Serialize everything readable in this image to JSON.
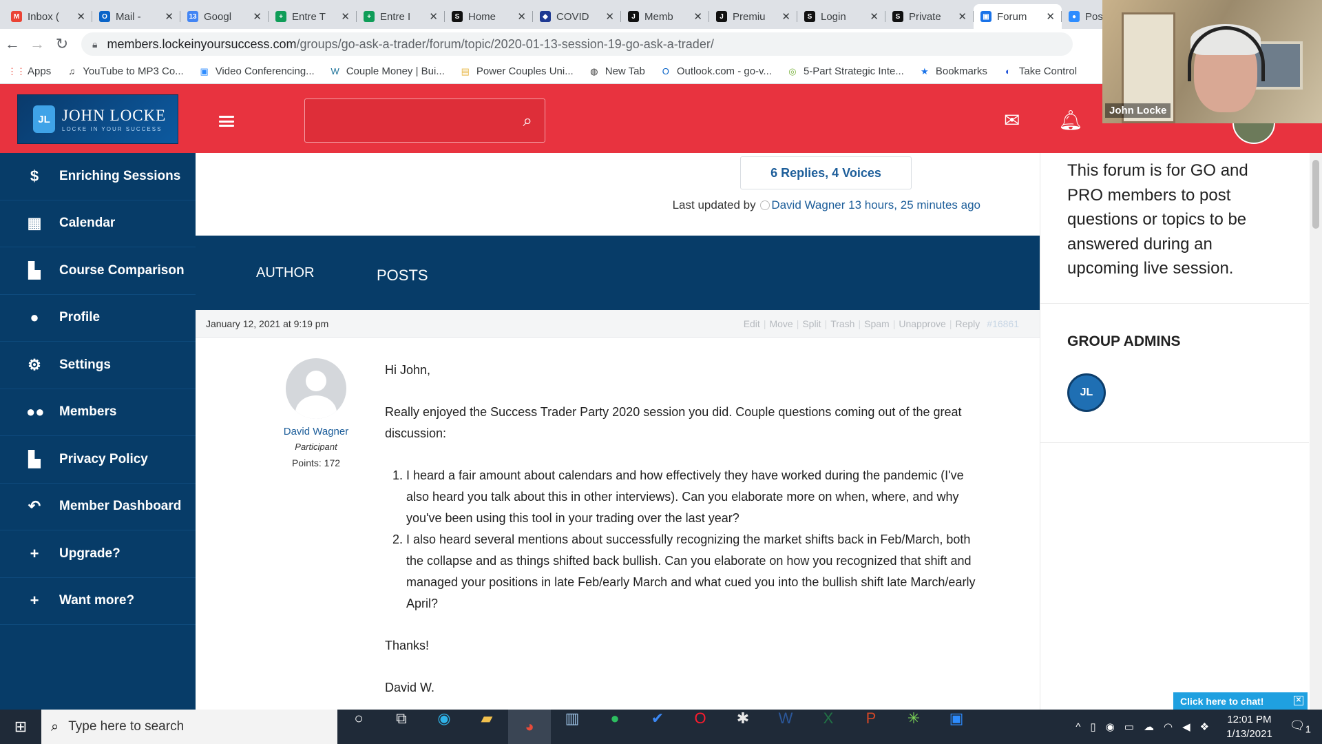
{
  "browser": {
    "tabs": [
      {
        "title": "Inbox (",
        "fav": "M",
        "color": "#ea4335",
        "active": false
      },
      {
        "title": "Mail -",
        "fav": "O",
        "color": "#0a64c8",
        "active": false
      },
      {
        "title": "Googl",
        "fav": "13",
        "color": "#4285f4",
        "active": false
      },
      {
        "title": "Entre T",
        "fav": "+",
        "color": "#0f9d58",
        "active": false
      },
      {
        "title": "Entre I",
        "fav": "+",
        "color": "#0f9d58",
        "active": false
      },
      {
        "title": "Home",
        "fav": "S",
        "color": "#111111",
        "active": false
      },
      {
        "title": "COVID",
        "fav": "◆",
        "color": "#1f3a93",
        "active": false
      },
      {
        "title": "Memb",
        "fav": "J",
        "color": "#111111",
        "active": false
      },
      {
        "title": "Premiu",
        "fav": "J",
        "color": "#111111",
        "active": false
      },
      {
        "title": "Login",
        "fav": "S",
        "color": "#111111",
        "active": false
      },
      {
        "title": "Private",
        "fav": "S",
        "color": "#111111",
        "active": false
      },
      {
        "title": "Forum",
        "fav": "▣",
        "color": "#1a73e8",
        "active": true
      },
      {
        "title": "Post A",
        "fav": "●",
        "color": "#2d8cff",
        "active": false
      }
    ],
    "url_domain": "members.lockeinyoursuccess.com",
    "url_path": "/groups/go-ask-a-trader/forum/topic/2020-01-13-session-19-go-ask-a-trader/",
    "bookmarks": [
      {
        "label": "Apps",
        "icon": "⋮⋮",
        "color": "#ea4335"
      },
      {
        "label": "YouTube to MP3 Co...",
        "icon": "♫",
        "color": "#333333"
      },
      {
        "label": "Video Conferencing...",
        "icon": "▣",
        "color": "#2d8cff"
      },
      {
        "label": "Couple Money | Bui...",
        "icon": "W",
        "color": "#21759b"
      },
      {
        "label": "Power Couples Uni...",
        "icon": "▤",
        "color": "#e8b84a"
      },
      {
        "label": "New Tab",
        "icon": "◍",
        "color": "#333333"
      },
      {
        "label": "Outlook.com - go-v...",
        "icon": "O",
        "color": "#0a64c8"
      },
      {
        "label": "5-Part Strategic Inte...",
        "icon": "◎",
        "color": "#7cb342"
      },
      {
        "label": "Bookmarks",
        "icon": "★",
        "color": "#1a73e8"
      },
      {
        "label": "Take Control",
        "icon": "◐",
        "color": "#1a4fd8"
      }
    ]
  },
  "site": {
    "logo_name": "JOHN LOCKE",
    "logo_tagline": "LOCKE IN YOUR SUCCESS",
    "logo_mark": "JL",
    "user_name": "John Locke"
  },
  "sidebar": {
    "items": [
      {
        "label": "Enriching Sessions",
        "icon": "$"
      },
      {
        "label": "Calendar",
        "icon": "▦"
      },
      {
        "label": "Course Comparison",
        "icon": "▙"
      },
      {
        "label": "Profile",
        "icon": "●"
      },
      {
        "label": "Settings",
        "icon": "⚙"
      },
      {
        "label": "Members",
        "icon": "●●"
      },
      {
        "label": "Privacy Policy",
        "icon": "▙"
      },
      {
        "label": "Member Dashboard",
        "icon": "↶"
      },
      {
        "label": "Upgrade?",
        "icon": "+"
      },
      {
        "label": "Want more?",
        "icon": "+"
      }
    ]
  },
  "topic": {
    "replies_voices": "6 Replies, 4 Voices",
    "last_updated_prefix": "Last updated by",
    "last_updated_user": "David Wagner",
    "last_updated_time": "13 hours, 25 minutes ago",
    "col_author": "AUTHOR",
    "col_posts": "POSTS"
  },
  "post": {
    "date": "January 12, 2021 at 9:19 pm",
    "actions": [
      "Edit",
      "Move",
      "Split",
      "Trash",
      "Spam",
      "Unapprove",
      "Reply"
    ],
    "post_id": "#16861",
    "author_name": "David Wagner",
    "author_role": "Participant",
    "author_points": "Points: 172",
    "greeting": "Hi John,",
    "intro": "Really enjoyed the Success Trader Party 2020 session you did.  Couple questions coming out of the great discussion:",
    "questions": [
      "I heard a fair amount about calendars and how effectively they have worked during the pandemic (I've also heard you talk about this in other interviews).  Can you elaborate more on when, where, and why you've been using this tool in your trading over the last year?",
      "I also heard several mentions about successfully recognizing the market shifts back in Feb/March, both the collapse and as things shifted back bullish.  Can you elaborate on how you recognized that shift and managed your positions in late Feb/early March and what cued you into the bullish shift late March/early April?"
    ],
    "thanks": "Thanks!",
    "signoff": "David W."
  },
  "right_panel": {
    "description": "This forum is for GO and PRO members to post questions or topics to be answered during an upcoming live session.",
    "group_admins_heading": "GROUP ADMINS",
    "admin_mark": "JL"
  },
  "chat_widget": {
    "label": "Click here to chat!"
  },
  "video_overlay": {
    "name": "John Locke"
  },
  "taskbar": {
    "search_placeholder": "Type here to search",
    "apps": [
      {
        "name": "cortana-icon",
        "glyph": "○",
        "color": "#ffffff",
        "active": false
      },
      {
        "name": "task-view-icon",
        "glyph": "⧉",
        "color": "#ffffff",
        "active": false
      },
      {
        "name": "edge-icon",
        "glyph": "◉",
        "color": "#2fb3e8",
        "active": false
      },
      {
        "name": "file-explorer-icon",
        "glyph": "▰",
        "color": "#f2c14e",
        "active": false
      },
      {
        "name": "chrome-icon",
        "glyph": "◕",
        "color": "#e84b3a",
        "active": true
      },
      {
        "name": "app-icon",
        "glyph": "▥",
        "color": "#9ec3e6",
        "active": false
      },
      {
        "name": "evernote-icon",
        "glyph": "●",
        "color": "#2dbe60",
        "active": false
      },
      {
        "name": "todo-icon",
        "glyph": "✔",
        "color": "#3b88f5",
        "active": false
      },
      {
        "name": "opera-icon",
        "glyph": "O",
        "color": "#ff1b2d",
        "active": false
      },
      {
        "name": "slack-icon",
        "glyph": "✱",
        "color": "#e8e8e8",
        "active": false
      },
      {
        "name": "word-icon",
        "glyph": "W",
        "color": "#2b579a",
        "active": false
      },
      {
        "name": "excel-icon",
        "glyph": "X",
        "color": "#217346",
        "active": false
      },
      {
        "name": "powerpoint-icon",
        "glyph": "P",
        "color": "#d24726",
        "active": false
      },
      {
        "name": "app-icon",
        "glyph": "✳",
        "color": "#7ed957",
        "active": false
      },
      {
        "name": "zoom-icon",
        "glyph": "▣",
        "color": "#2d8cff",
        "active": false
      }
    ],
    "time": "12:01 PM",
    "date": "1/13/2021",
    "notification_count": "1"
  },
  "colors": {
    "header_red": "#e8333f",
    "nav_blue": "#073c68",
    "link_blue": "#1d5e9a"
  }
}
